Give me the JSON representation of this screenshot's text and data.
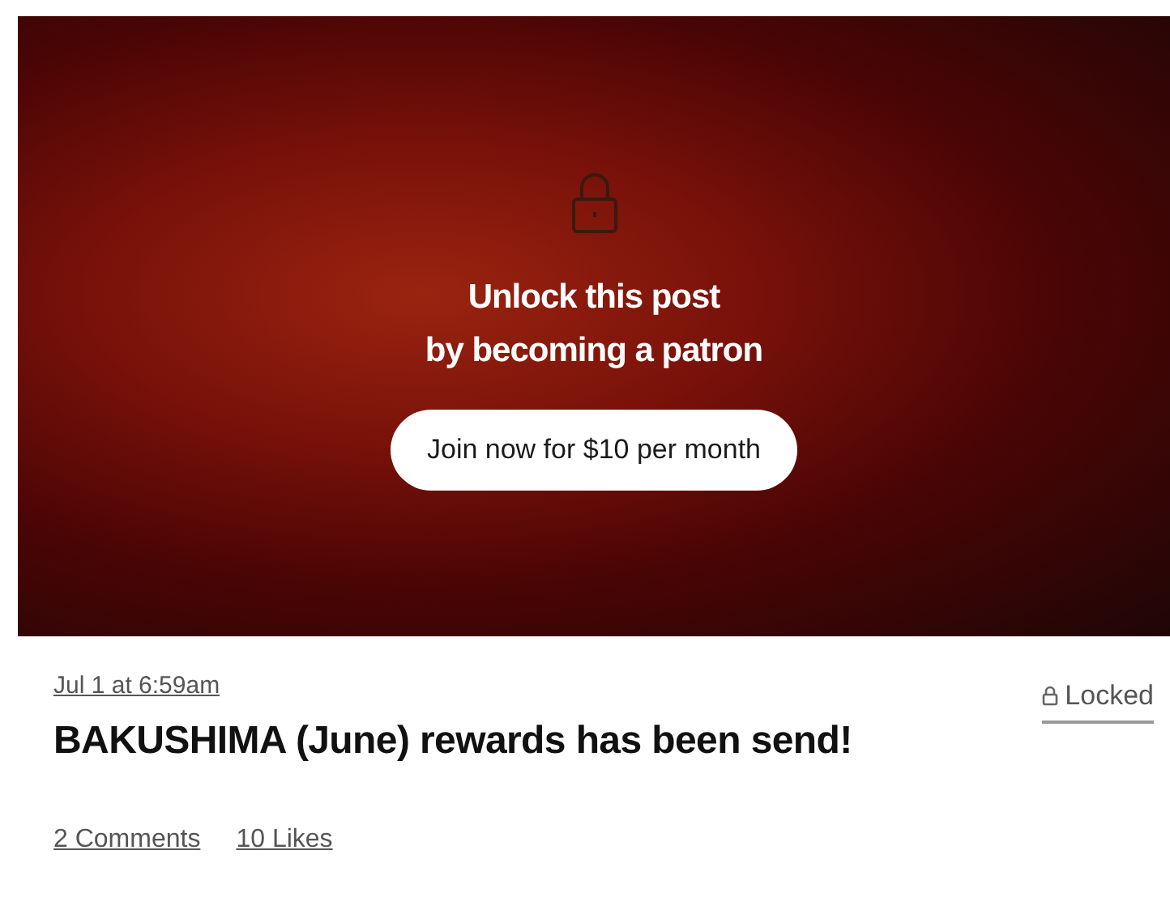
{
  "banner": {
    "heading_lines": [
      "Unlock this post",
      "by becoming a patron"
    ],
    "join_button": "Join now for $10 per month"
  },
  "post": {
    "date": "Jul 1 at 6:59am",
    "status": "Locked",
    "title": "BAKUSHIMA (June) rewards has been send!"
  },
  "stats": [
    "2 Comments",
    "10 Likes"
  ]
}
